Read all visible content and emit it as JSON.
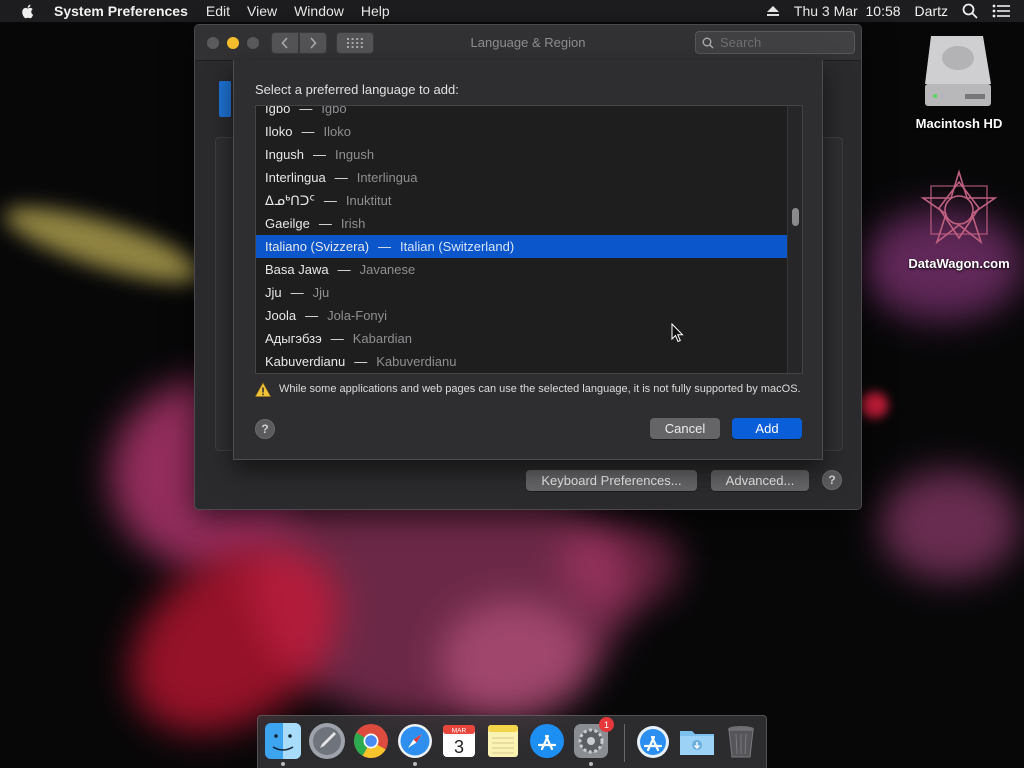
{
  "menubar": {
    "app_name": "System Preferences",
    "items": [
      "Edit",
      "View",
      "Window",
      "Help"
    ],
    "clock": "Thu 3 Mar  10:58",
    "user": "Dartz"
  },
  "window": {
    "title": "Language & Region",
    "search_placeholder": "Search",
    "keyboard_prefs_label": "Keyboard Preferences...",
    "advanced_label": "Advanced...",
    "help_label": "?"
  },
  "sheet": {
    "title": "Select a preferred language to add:",
    "languages": [
      {
        "native": "Igbo",
        "english": "Igbo"
      },
      {
        "native": "Iloko",
        "english": "Iloko"
      },
      {
        "native": "Ingush",
        "english": "Ingush"
      },
      {
        "native": "Interlingua",
        "english": "Interlingua"
      },
      {
        "native": "ᐃᓄᒃᑎᑐᑦ",
        "english": "Inuktitut"
      },
      {
        "native": "Gaeilge",
        "english": "Irish"
      },
      {
        "native": "Italiano (Svizzera)",
        "english": "Italian (Switzerland)",
        "selected": true
      },
      {
        "native": "Basa Jawa",
        "english": "Javanese"
      },
      {
        "native": "Jju",
        "english": "Jju"
      },
      {
        "native": "Joola",
        "english": "Jola-Fonyi"
      },
      {
        "native": "Адыгэбзэ",
        "english": "Kabardian"
      },
      {
        "native": "Kabuverdianu",
        "english": "Kabuverdianu"
      }
    ],
    "warning": "While some applications and web pages can use the selected language, it is not fully supported by macOS.",
    "help_label": "?",
    "cancel_label": "Cancel",
    "add_label": "Add"
  },
  "desktop": {
    "hd_label": "Macintosh HD",
    "site_label": "DataWagon.com"
  },
  "dock": {
    "calendar_month": "MAR",
    "calendar_day": "3",
    "prefs_badge": "1"
  },
  "colors": {
    "selection": "#0b56cb",
    "accent_button": "#0a5fd9",
    "minimize_light": "#f5bf2e"
  }
}
